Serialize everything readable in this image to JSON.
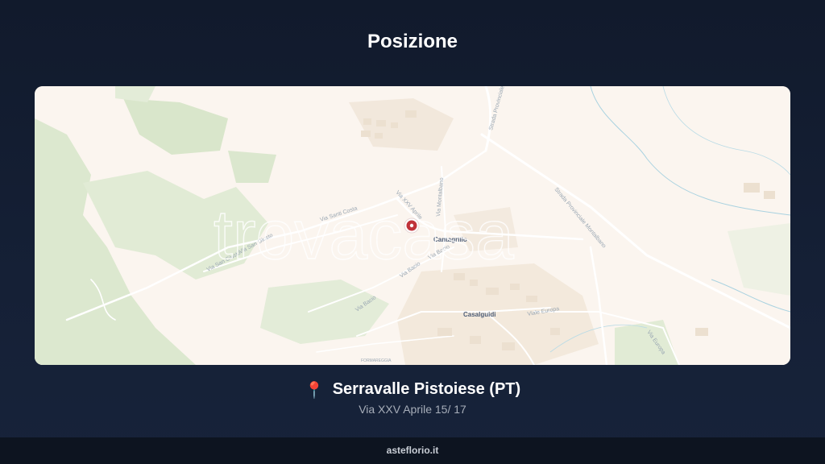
{
  "title": "Posizione",
  "map": {
    "watermark": "trovacasa",
    "towns": [
      "Cantagrillo",
      "Casalguidi"
    ],
    "streets": [
      "Strada Provinciale",
      "Strada Provinciale Montalbano",
      "Via Montalbano",
      "Via XXV Aprile",
      "Via San Giusto",
      "Via San Giusto",
      "Via Bacio",
      "Via Bacio",
      "Via Bacio",
      "Viale Europa",
      "Via Europa",
      "Via Santi Costa"
    ],
    "poi": "FORMAREGGIA",
    "marker_icon": "map-marker-icon",
    "colors": {
      "land": "#fbf5ef",
      "green": "#dce8cf",
      "water": "#8fc4d8",
      "marker": "#c0323a"
    }
  },
  "location": {
    "pin_icon": "📍",
    "name": "Serravalle Pistoiese (PT)",
    "address": "Via XXV Aprile 15/ 17"
  },
  "footer": {
    "site": "asteflorio.it"
  }
}
